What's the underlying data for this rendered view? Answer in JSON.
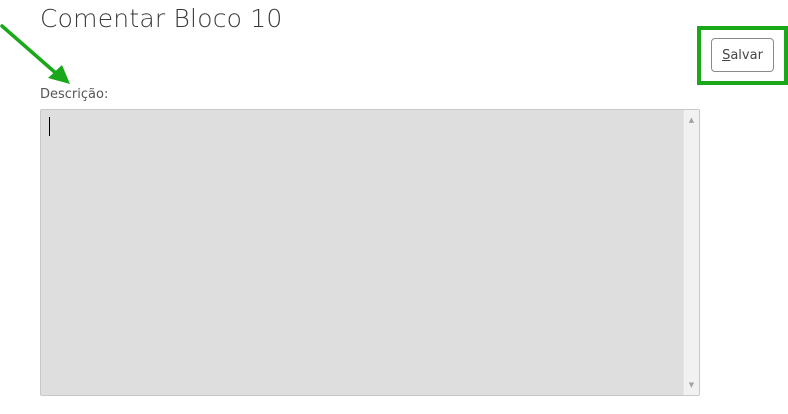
{
  "form": {
    "title": "Comentar Bloco 10",
    "description_label": "Descrição:",
    "description_value": "",
    "save_button": {
      "accel": "S",
      "rest": "alvar"
    }
  },
  "colors": {
    "highlight": "#1aa71a",
    "arrow": "#1aa71a",
    "textarea_bg": "#dedede"
  },
  "icons": {
    "scroll_up": "▲",
    "scroll_down": "▼"
  }
}
